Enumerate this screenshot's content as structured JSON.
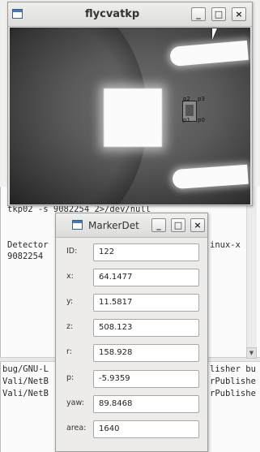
{
  "camera_window": {
    "title": "flycvatkp",
    "minimize": "_",
    "maximize": "□",
    "close": "×",
    "marker_labels": {
      "p2": "p2",
      "p3": "p3",
      "p1": "p1",
      "p0": "p0"
    }
  },
  "terminal": {
    "lines": [
      "tkp02 -s 9082254 2>/dev/null",
      "Detector",
      "9082254",
      "inux-x",
      "bug/GNU-L",
      "Vali/NetB",
      "Vali/NetB",
      "lisher bu",
      "rPublishe",
      "rPublishe"
    ]
  },
  "marker_window": {
    "title": "MarkerDet",
    "minimize": "_",
    "maximize": "□",
    "close": "×",
    "fields": [
      {
        "label": "ID:",
        "value": "122"
      },
      {
        "label": "x:",
        "value": "64.1477"
      },
      {
        "label": "y:",
        "value": "11.5817"
      },
      {
        "label": "z:",
        "value": "508.123"
      },
      {
        "label": "r:",
        "value": "158.928"
      },
      {
        "label": "p:",
        "value": "-5.9359"
      },
      {
        "label": "yaw:",
        "value": "89.8468"
      },
      {
        "label": "area:",
        "value": "1640"
      }
    ]
  }
}
